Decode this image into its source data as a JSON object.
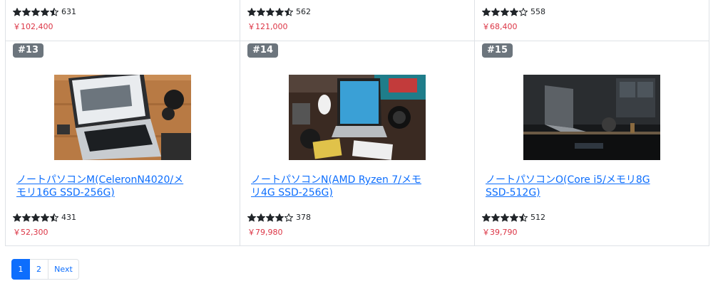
{
  "top_row": [
    {
      "rating": 4.5,
      "reviews": "631",
      "price": "￥102,400"
    },
    {
      "rating": 4.5,
      "reviews": "562",
      "price": "￥121,000"
    },
    {
      "rating": 4,
      "reviews": "558",
      "price": "￥68,400"
    }
  ],
  "products": [
    {
      "badge": "#13",
      "title": "ノートパソコンM(CeleronN4020/メモリ16G SSD-256G)",
      "rating": 4.5,
      "reviews": "431",
      "price": "￥52,300",
      "image": "laptop-on-wood-desk"
    },
    {
      "badge": "#14",
      "title": "ノートパソコンN(AMD Ryzen 7/メモリ4G SSD-256G)",
      "rating": 4,
      "reviews": "378",
      "price": "￥79,980",
      "image": "laptop-with-cameras"
    },
    {
      "badge": "#15",
      "title": "ノートパソコンO(Core i5/メモリ8G SSD-512G)",
      "rating": 4.5,
      "reviews": "512",
      "price": "￥39,790",
      "image": "laptop-in-dark-room"
    }
  ],
  "pagination": {
    "page1": "1",
    "page2": "2",
    "next": "Next",
    "current": "1"
  },
  "colors": {
    "link": "#0d6efd",
    "price": "#dc3545",
    "badge": "#6c757d"
  },
  "icons": {
    "full": "star-full-icon",
    "half": "star-half-icon",
    "empty": "star-empty-icon"
  }
}
